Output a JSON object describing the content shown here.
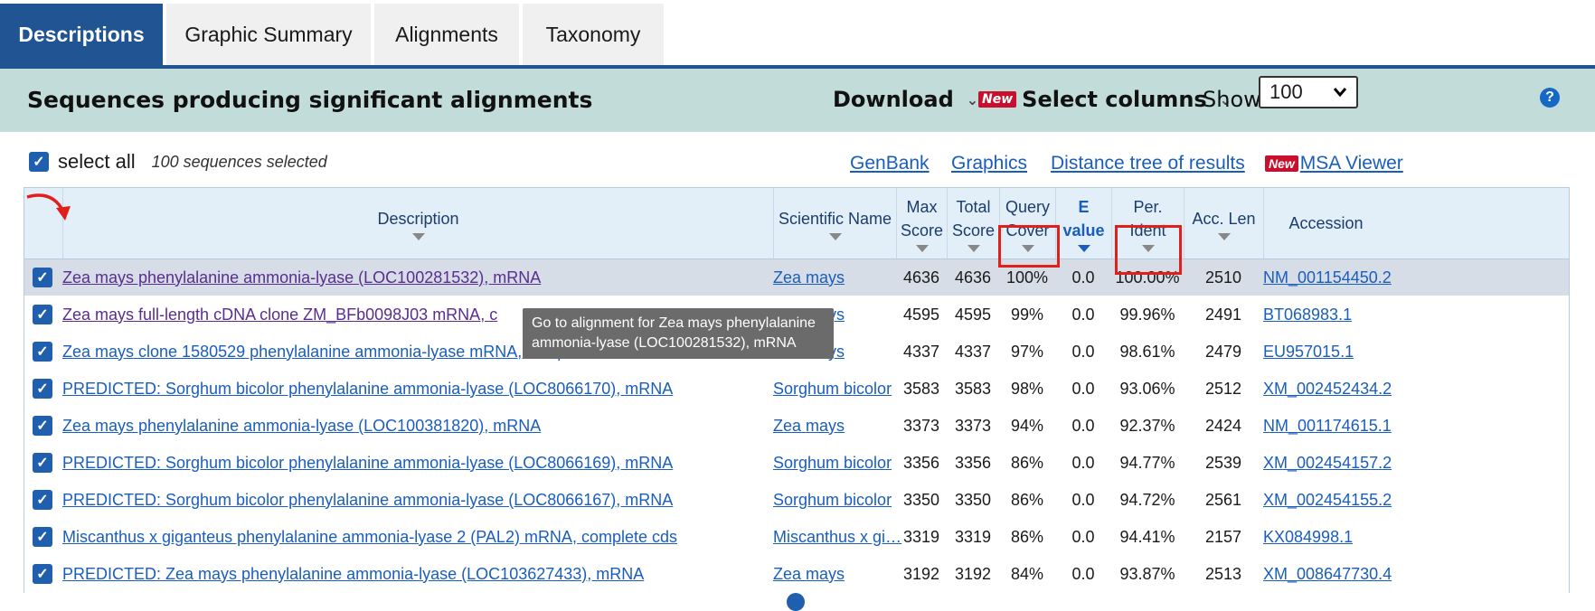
{
  "tabs": [
    {
      "label": "Descriptions"
    },
    {
      "label": "Graphic Summary"
    },
    {
      "label": "Alignments"
    },
    {
      "label": "Taxonomy"
    }
  ],
  "header": {
    "title": "Sequences producing significant alignments",
    "download_label": "Download",
    "new_badge": "New",
    "select_columns_label": "Select columns",
    "show_label": "Show",
    "show_value": "100",
    "help_glyph": "?"
  },
  "selection": {
    "select_all_label": "select all",
    "count_text": "100 sequences selected"
  },
  "links": {
    "genbank": "GenBank",
    "graphics": "Graphics",
    "distance_tree": "Distance tree of results",
    "msa_new_badge": "New",
    "msa_viewer": "MSA Viewer"
  },
  "columns": {
    "description": "Description",
    "scientific_name": "Scientific Name",
    "max_score": [
      "Max",
      "Score"
    ],
    "total_score": [
      "Total",
      "Score"
    ],
    "query_cover": [
      "Query",
      "Cover"
    ],
    "e_value": [
      "E",
      "value"
    ],
    "per_ident": [
      "Per.",
      "Ident"
    ],
    "acc_len": "Acc. Len",
    "accession": "Accession"
  },
  "rows": [
    {
      "description": "Zea mays phenylalanine ammonia-lyase (LOC100281532), mRNA",
      "scientific_name": "Zea mays",
      "max_score": "4636",
      "total_score": "4636",
      "query_cover": "100%",
      "e_value": "0.0",
      "per_ident": "100.00%",
      "acc_len": "2510",
      "accession": "NM_001154450.2"
    },
    {
      "description": "Zea mays full-length cDNA clone ZM_BFb0098J03 mRNA, c",
      "scientific_name": "Zea mays",
      "max_score": "4595",
      "total_score": "4595",
      "query_cover": "99%",
      "e_value": "0.0",
      "per_ident": "99.96%",
      "acc_len": "2491",
      "accession": "BT068983.1"
    },
    {
      "description": "Zea mays clone 1580529 phenylalanine ammonia-lyase mRNA, complete cds",
      "scientific_name": "Zea mays",
      "max_score": "4337",
      "total_score": "4337",
      "query_cover": "97%",
      "e_value": "0.0",
      "per_ident": "98.61%",
      "acc_len": "2479",
      "accession": "EU957015.1"
    },
    {
      "description": "PREDICTED: Sorghum bicolor phenylalanine ammonia-lyase (LOC8066170), mRNA",
      "scientific_name": "Sorghum bicolor",
      "max_score": "3583",
      "total_score": "3583",
      "query_cover": "98%",
      "e_value": "0.0",
      "per_ident": "93.06%",
      "acc_len": "2512",
      "accession": "XM_002452434.2"
    },
    {
      "description": "Zea mays phenylalanine ammonia-lyase (LOC100381820), mRNA",
      "scientific_name": "Zea mays",
      "max_score": "3373",
      "total_score": "3373",
      "query_cover": "94%",
      "e_value": "0.0",
      "per_ident": "92.37%",
      "acc_len": "2424",
      "accession": "NM_001174615.1"
    },
    {
      "description": "PREDICTED: Sorghum bicolor phenylalanine ammonia-lyase (LOC8066169), mRNA",
      "scientific_name": "Sorghum bicolor",
      "max_score": "3356",
      "total_score": "3356",
      "query_cover": "86%",
      "e_value": "0.0",
      "per_ident": "94.77%",
      "acc_len": "2539",
      "accession": "XM_002454157.2"
    },
    {
      "description": "PREDICTED: Sorghum bicolor phenylalanine ammonia-lyase (LOC8066167), mRNA",
      "scientific_name": "Sorghum bicolor",
      "max_score": "3350",
      "total_score": "3350",
      "query_cover": "86%",
      "e_value": "0.0",
      "per_ident": "94.72%",
      "acc_len": "2561",
      "accession": "XM_002454155.2"
    },
    {
      "description": "Miscanthus x giganteus phenylalanine ammonia-lyase 2 (PAL2) mRNA, complete cds",
      "scientific_name": "Miscanthus x gi…",
      "max_score": "3319",
      "total_score": "3319",
      "query_cover": "86%",
      "e_value": "0.0",
      "per_ident": "94.41%",
      "acc_len": "2157",
      "accession": "KX084998.1"
    },
    {
      "description": "PREDICTED: Zea mays phenylalanine ammonia-lyase (LOC103627433), mRNA",
      "scientific_name": "Zea mays",
      "max_score": "3192",
      "total_score": "3192",
      "query_cover": "84%",
      "e_value": "0.0",
      "per_ident": "93.87%",
      "acc_len": "2513",
      "accession": "XM_008647730.4"
    }
  ],
  "tooltip": {
    "line1": "Go to alignment for Zea mays phenylalanine",
    "line2": "ammonia-lyase (LOC100281532), mRNA"
  },
  "colors": {
    "primary_blue": "#205493",
    "header_band": "#c2dcd9",
    "link_blue": "#1a5ebd",
    "visited_purple": "#5a2d91",
    "highlight_red": "#e0201b"
  },
  "icons": {
    "checkbox": "checkmark-icon",
    "help": "help-icon",
    "chevron": "chevron-down-icon",
    "sort": "sort-triangle-icon",
    "annotation": "curved-arrow-icon"
  }
}
